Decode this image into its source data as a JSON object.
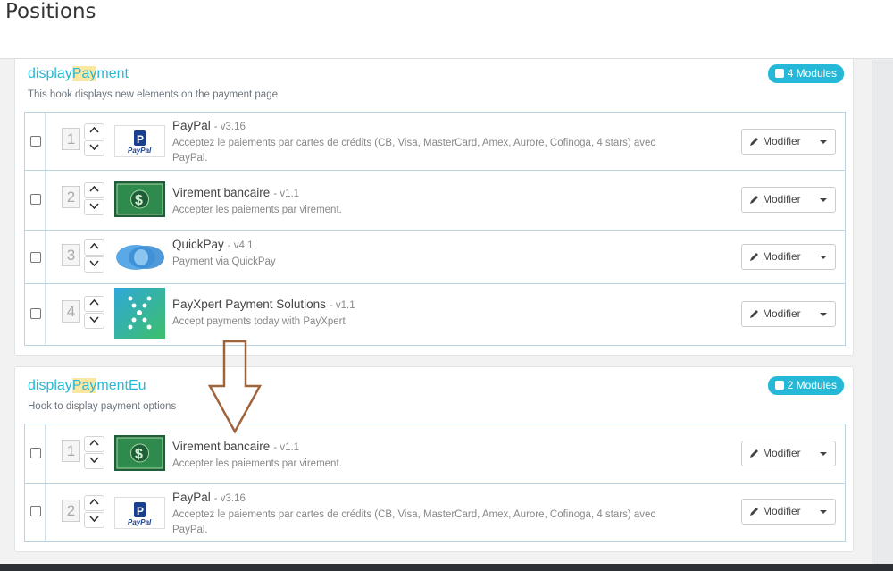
{
  "page": {
    "title": "Positions"
  },
  "hooks": [
    {
      "name_prefix": "display",
      "name_highlight": "Pay",
      "name_suffix": "ment",
      "description": "This hook displays new elements on the payment page",
      "badge": "4 Modules",
      "modules": [
        {
          "position": "1",
          "name": "PayPal",
          "version": "- v3.16",
          "description_line1": "Acceptez le paiements par cartes de crédits (CB, Visa, MasterCard, Amex, Aurore, Cofinoga, 4 stars) avec",
          "description_line2": "PayPal.",
          "logo": "paypal-logo",
          "logo_text": "PayPal",
          "button": "Modifier"
        },
        {
          "position": "2",
          "name": "Virement bancaire",
          "version": "- v1.1",
          "description_line1": "Accepter les paiements par virement.",
          "description_line2": "",
          "logo": "bank-transfer-logo",
          "logo_text": "$",
          "button": "Modifier"
        },
        {
          "position": "3",
          "name": "QuickPay",
          "version": "- v4.1",
          "description_line1": "Payment via QuickPay",
          "description_line2": "",
          "logo": "quickpay-logo",
          "button": "Modifier"
        },
        {
          "position": "4",
          "name": "PayXpert Payment Solutions",
          "version": "- v1.1",
          "description_line1": "Accept payments today with PayXpert",
          "description_line2": "",
          "logo": "payxpert-logo",
          "button": "Modifier"
        }
      ]
    },
    {
      "name_prefix": "display",
      "name_highlight": "Pay",
      "name_suffix": "mentEu",
      "description": "Hook to display payment options",
      "badge": "2 Modules",
      "modules": [
        {
          "position": "1",
          "name": "Virement bancaire",
          "version": "- v1.1",
          "description_line1": "Accepter les paiements par virement.",
          "description_line2": "",
          "logo": "bank-transfer-logo",
          "logo_text": "$",
          "button": "Modifier"
        },
        {
          "position": "2",
          "name": "PayPal",
          "version": "- v3.16",
          "description_line1": "Acceptez le paiements par cartes de crédits (CB, Visa, MasterCard, Amex, Aurore, Cofinoga, 4 stars) avec",
          "description_line2": "PayPal.",
          "logo": "paypal-logo",
          "logo_text": "PayPal",
          "button": "Modifier"
        }
      ]
    }
  ],
  "colors": {
    "accent": "#25b9d7",
    "highlight": "#fbe7a1",
    "annotation_arrow": "#a0643c"
  }
}
